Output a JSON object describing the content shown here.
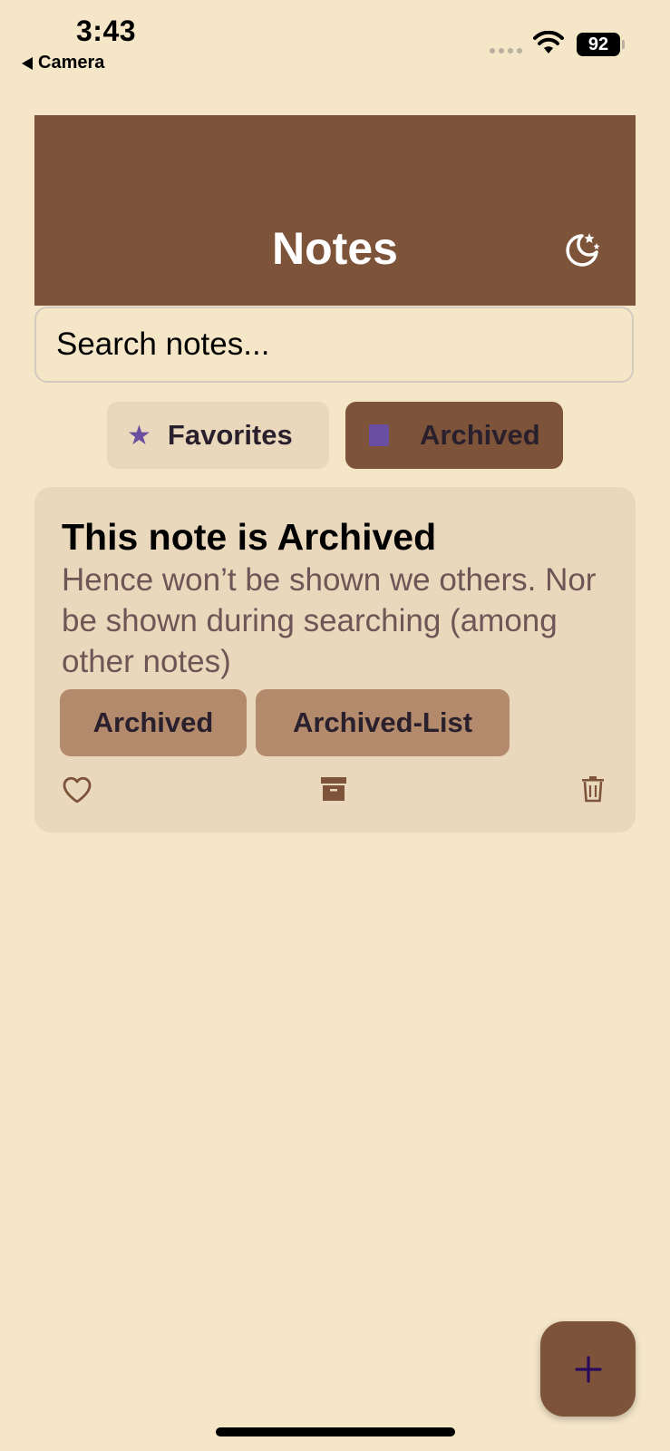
{
  "status_bar": {
    "time": "3:43",
    "back_label": "Camera",
    "battery": "92"
  },
  "header": {
    "title": "Notes",
    "theme_icon": "moon-stars-icon"
  },
  "search": {
    "placeholder": "Search notes..."
  },
  "filters": [
    {
      "label": "Favorites",
      "icon": "star-icon"
    },
    {
      "label": "Archived",
      "icon": "square-icon",
      "active": true
    }
  ],
  "note": {
    "title": "This note is Archived",
    "body": "Hence won’t be shown we others. Nor be shown during searching (among other notes)",
    "tags": [
      "Archived",
      "Archived-List"
    ],
    "actions": [
      "heart-icon",
      "archive-box-icon",
      "trash-icon"
    ]
  },
  "fab": {
    "icon": "plus-icon"
  },
  "colors": {
    "background": "#f5e6c8",
    "header": "#7d5439",
    "card": "#ead8bc",
    "tag": "#b38b6c",
    "accent_purple": "#6a4fa0"
  }
}
